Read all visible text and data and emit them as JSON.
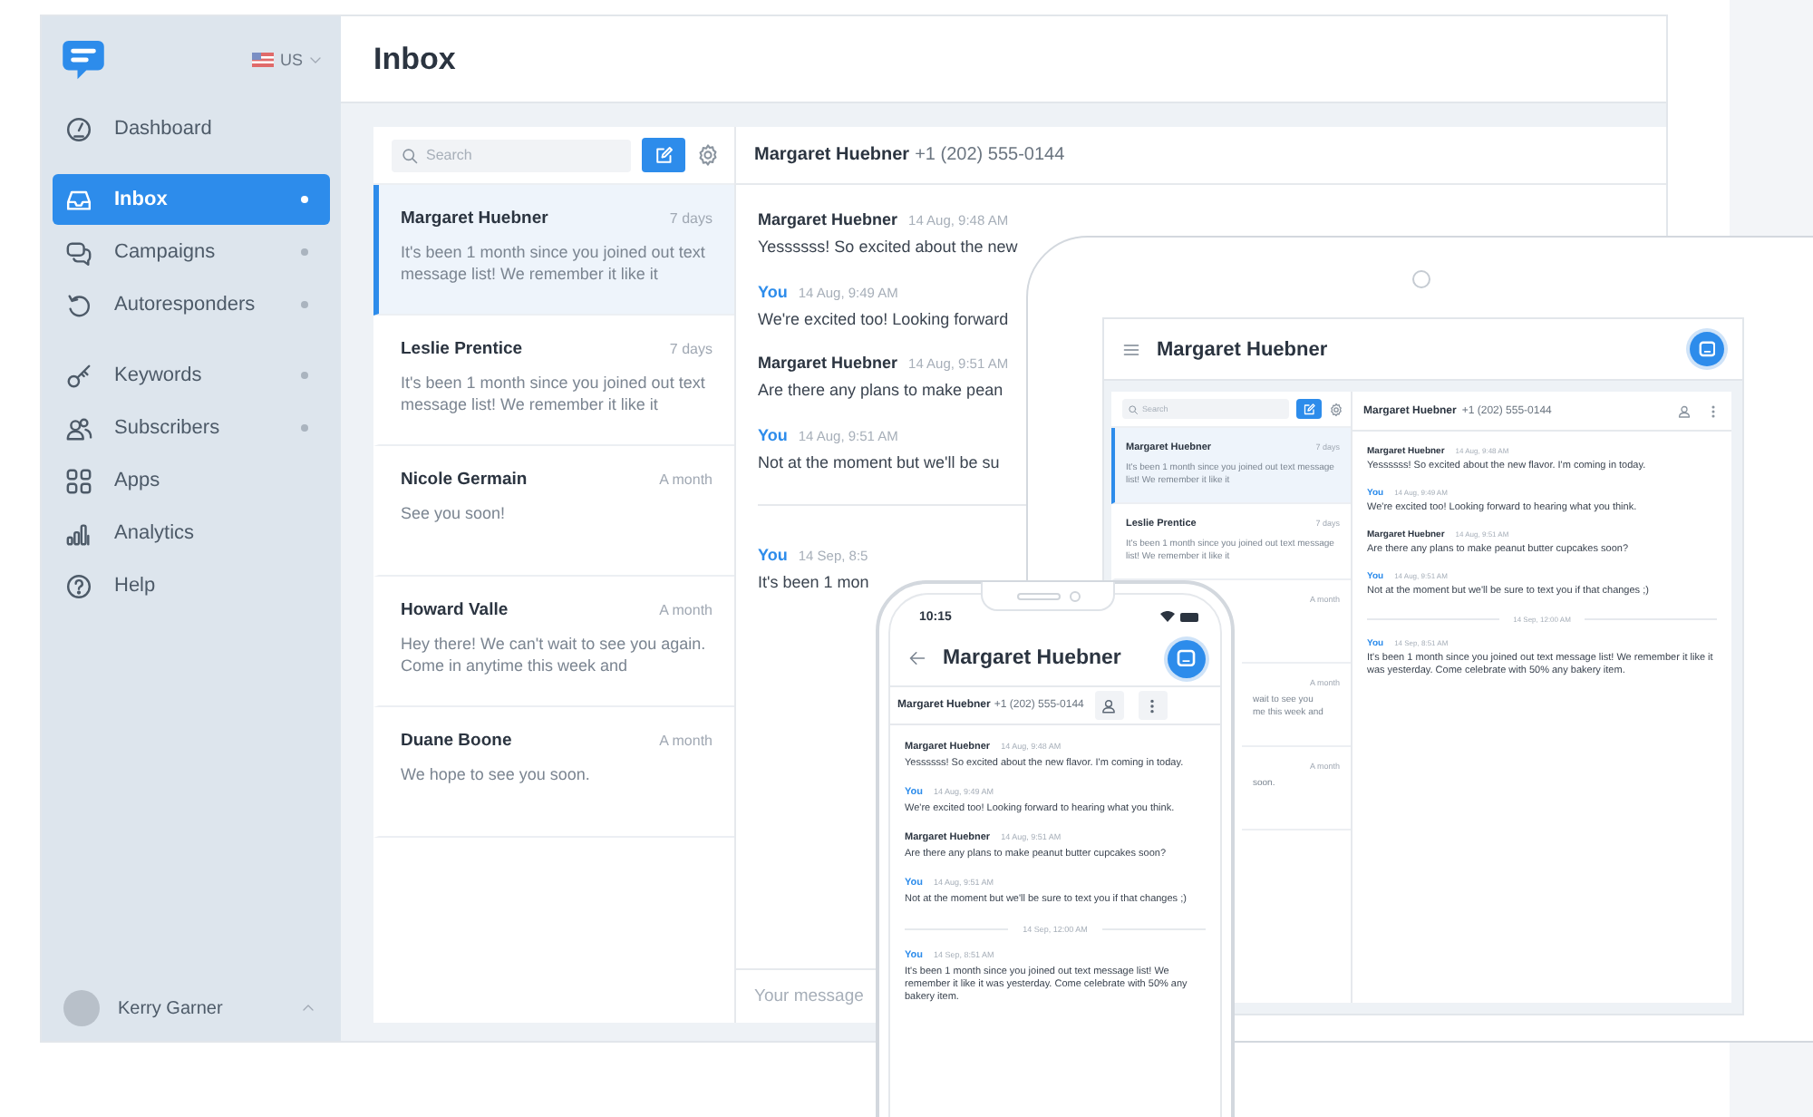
{
  "desktop": {
    "sidebar": {
      "locale": "US",
      "sections": [
        {
          "items": [
            {
              "label": "Dashboard",
              "selected": false,
              "dot": false
            }
          ]
        },
        {
          "items": [
            {
              "label": "Inbox",
              "selected": true,
              "dot": true
            },
            {
              "label": "Campaigns",
              "selected": false,
              "dot": true
            },
            {
              "label": "Autoresponders",
              "selected": false,
              "dot": true
            }
          ]
        },
        {
          "items": [
            {
              "label": "Keywords",
              "selected": false,
              "dot": true
            },
            {
              "label": "Subscribers",
              "selected": false,
              "dot": true
            },
            {
              "label": "Apps",
              "selected": false,
              "dot": false
            },
            {
              "label": "Analytics",
              "selected": false,
              "dot": false
            },
            {
              "label": "Help",
              "selected": false,
              "dot": false
            }
          ]
        }
      ],
      "user": {
        "name": "Kerry Garner"
      }
    },
    "title": "Inbox",
    "search": {
      "placeholder": "Search"
    },
    "conversations": [
      {
        "name": "Margaret Huebner",
        "time": "7 days",
        "preview": "It's been 1 month since you joined out text message list! We remember it like it",
        "selected": true
      },
      {
        "name": "Leslie Prentice",
        "time": "7 days",
        "preview": "It's been 1 month since you joined out text message list! We remember it like it",
        "selected": false
      },
      {
        "name": "Nicole Germain",
        "time": "A month",
        "preview": "See you soon!",
        "selected": false
      },
      {
        "name": "Howard Valle",
        "time": "A month",
        "preview": "Hey there! We can't wait to see you again. Come in anytime this week and",
        "selected": false
      },
      {
        "name": "Duane Boone",
        "time": "A month",
        "preview": "We hope to see you soon.",
        "selected": false
      }
    ],
    "thread": {
      "contact": "Margaret Huebner",
      "phone": "+1 (202) 555-0144",
      "messages": [
        {
          "kind": "contact",
          "sender": "Margaret Huebner",
          "time": "14 Aug, 9:48 AM",
          "text": "Yessssss! So excited about the new"
        },
        {
          "kind": "you",
          "sender": "You",
          "time": "14 Aug, 9:49 AM",
          "text": "We're excited too! Looking forward"
        },
        {
          "kind": "contact",
          "sender": "Margaret Huebner",
          "time": "14 Aug, 9:51 AM",
          "text": "Are there any plans to make pean"
        },
        {
          "kind": "you",
          "sender": "You",
          "time": "14 Aug, 9:51 AM",
          "text": "Not at the moment but we'll be su"
        },
        {
          "kind": "divider"
        },
        {
          "kind": "you",
          "sender": "You",
          "time": "14 Sep, 8:5",
          "text": "It's been 1 mon"
        }
      ],
      "composer": {
        "placeholder": "Your message"
      }
    }
  },
  "tablet": {
    "title": "Margaret Huebner",
    "search": {
      "placeholder": "Search"
    },
    "conversations": [
      {
        "name": "Margaret Huebner",
        "time": "7 days",
        "preview": "It's been 1 month since you joined out text message list! We remember it like it",
        "selected": true
      },
      {
        "name": "Leslie Prentice",
        "time": "7 days",
        "preview": "It's been 1 month since you joined out text message list! We remember it like it",
        "selected": false
      },
      {
        "time": "A month",
        "selected": false
      },
      {
        "time": "A month",
        "preview_lines": [
          "wait to see you",
          "me this week and"
        ],
        "selected": false
      },
      {
        "time": "A month",
        "preview_lines": [
          "soon."
        ],
        "selected": false
      }
    ],
    "thread": {
      "contact": "Margaret Huebner",
      "phone": "+1 (202) 555-0144",
      "messages": [
        {
          "kind": "contact",
          "sender": "Margaret Huebner",
          "time": "14 Aug, 9:48 AM",
          "text": "Yessssss! So excited about the new flavor. I'm coming in today."
        },
        {
          "kind": "you",
          "sender": "You",
          "time": "14 Aug, 9:49 AM",
          "text": "We're excited too! Looking forward to hearing what you think."
        },
        {
          "kind": "contact",
          "sender": "Margaret Huebner",
          "time": "14 Aug, 9:51 AM",
          "text": "Are there any plans to make peanut butter cupcakes soon?"
        },
        {
          "kind": "you",
          "sender": "You",
          "time": "14 Aug, 9:51 AM",
          "text": "Not at the moment but we'll be sure to text you if that changes ;)"
        },
        {
          "kind": "divider",
          "label": "14 Sep, 12:00 AM"
        },
        {
          "kind": "you",
          "sender": "You",
          "time": "14 Sep, 8:51 AM",
          "text": "It's been 1 month since you joined out text message list! We remember it like it was yesterday. Come celebrate with 50% any bakery item."
        }
      ]
    }
  },
  "phone": {
    "clock": "10:15",
    "title": "Margaret Huebner",
    "thread": {
      "contact": "Margaret Huebner",
      "phone": "+1 (202) 555-0144",
      "messages": [
        {
          "kind": "contact",
          "sender": "Margaret Huebner",
          "time": "14 Aug, 9:48 AM",
          "text": "Yessssss! So excited about the new flavor. I'm coming in today."
        },
        {
          "kind": "you",
          "sender": "You",
          "time": "14 Aug, 9:49 AM",
          "text": "We're excited too! Looking forward to hearing what you think."
        },
        {
          "kind": "contact",
          "sender": "Margaret Huebner",
          "time": "14 Aug, 9:51 AM",
          "text": "Are there any plans to make peanut butter cupcakes soon?"
        },
        {
          "kind": "you",
          "sender": "You",
          "time": "14 Aug, 9:51 AM",
          "text": "Not at the moment but we'll be sure to text you if that changes ;)"
        },
        {
          "kind": "divider",
          "label": "14 Sep, 12:00 AM"
        },
        {
          "kind": "you",
          "sender": "You",
          "time": "14 Sep, 8:51 AM",
          "text": "It's been 1 month since you joined out text message list! We remember it like it was yesterday. Come celebrate with 50% any bakery item."
        }
      ]
    }
  }
}
